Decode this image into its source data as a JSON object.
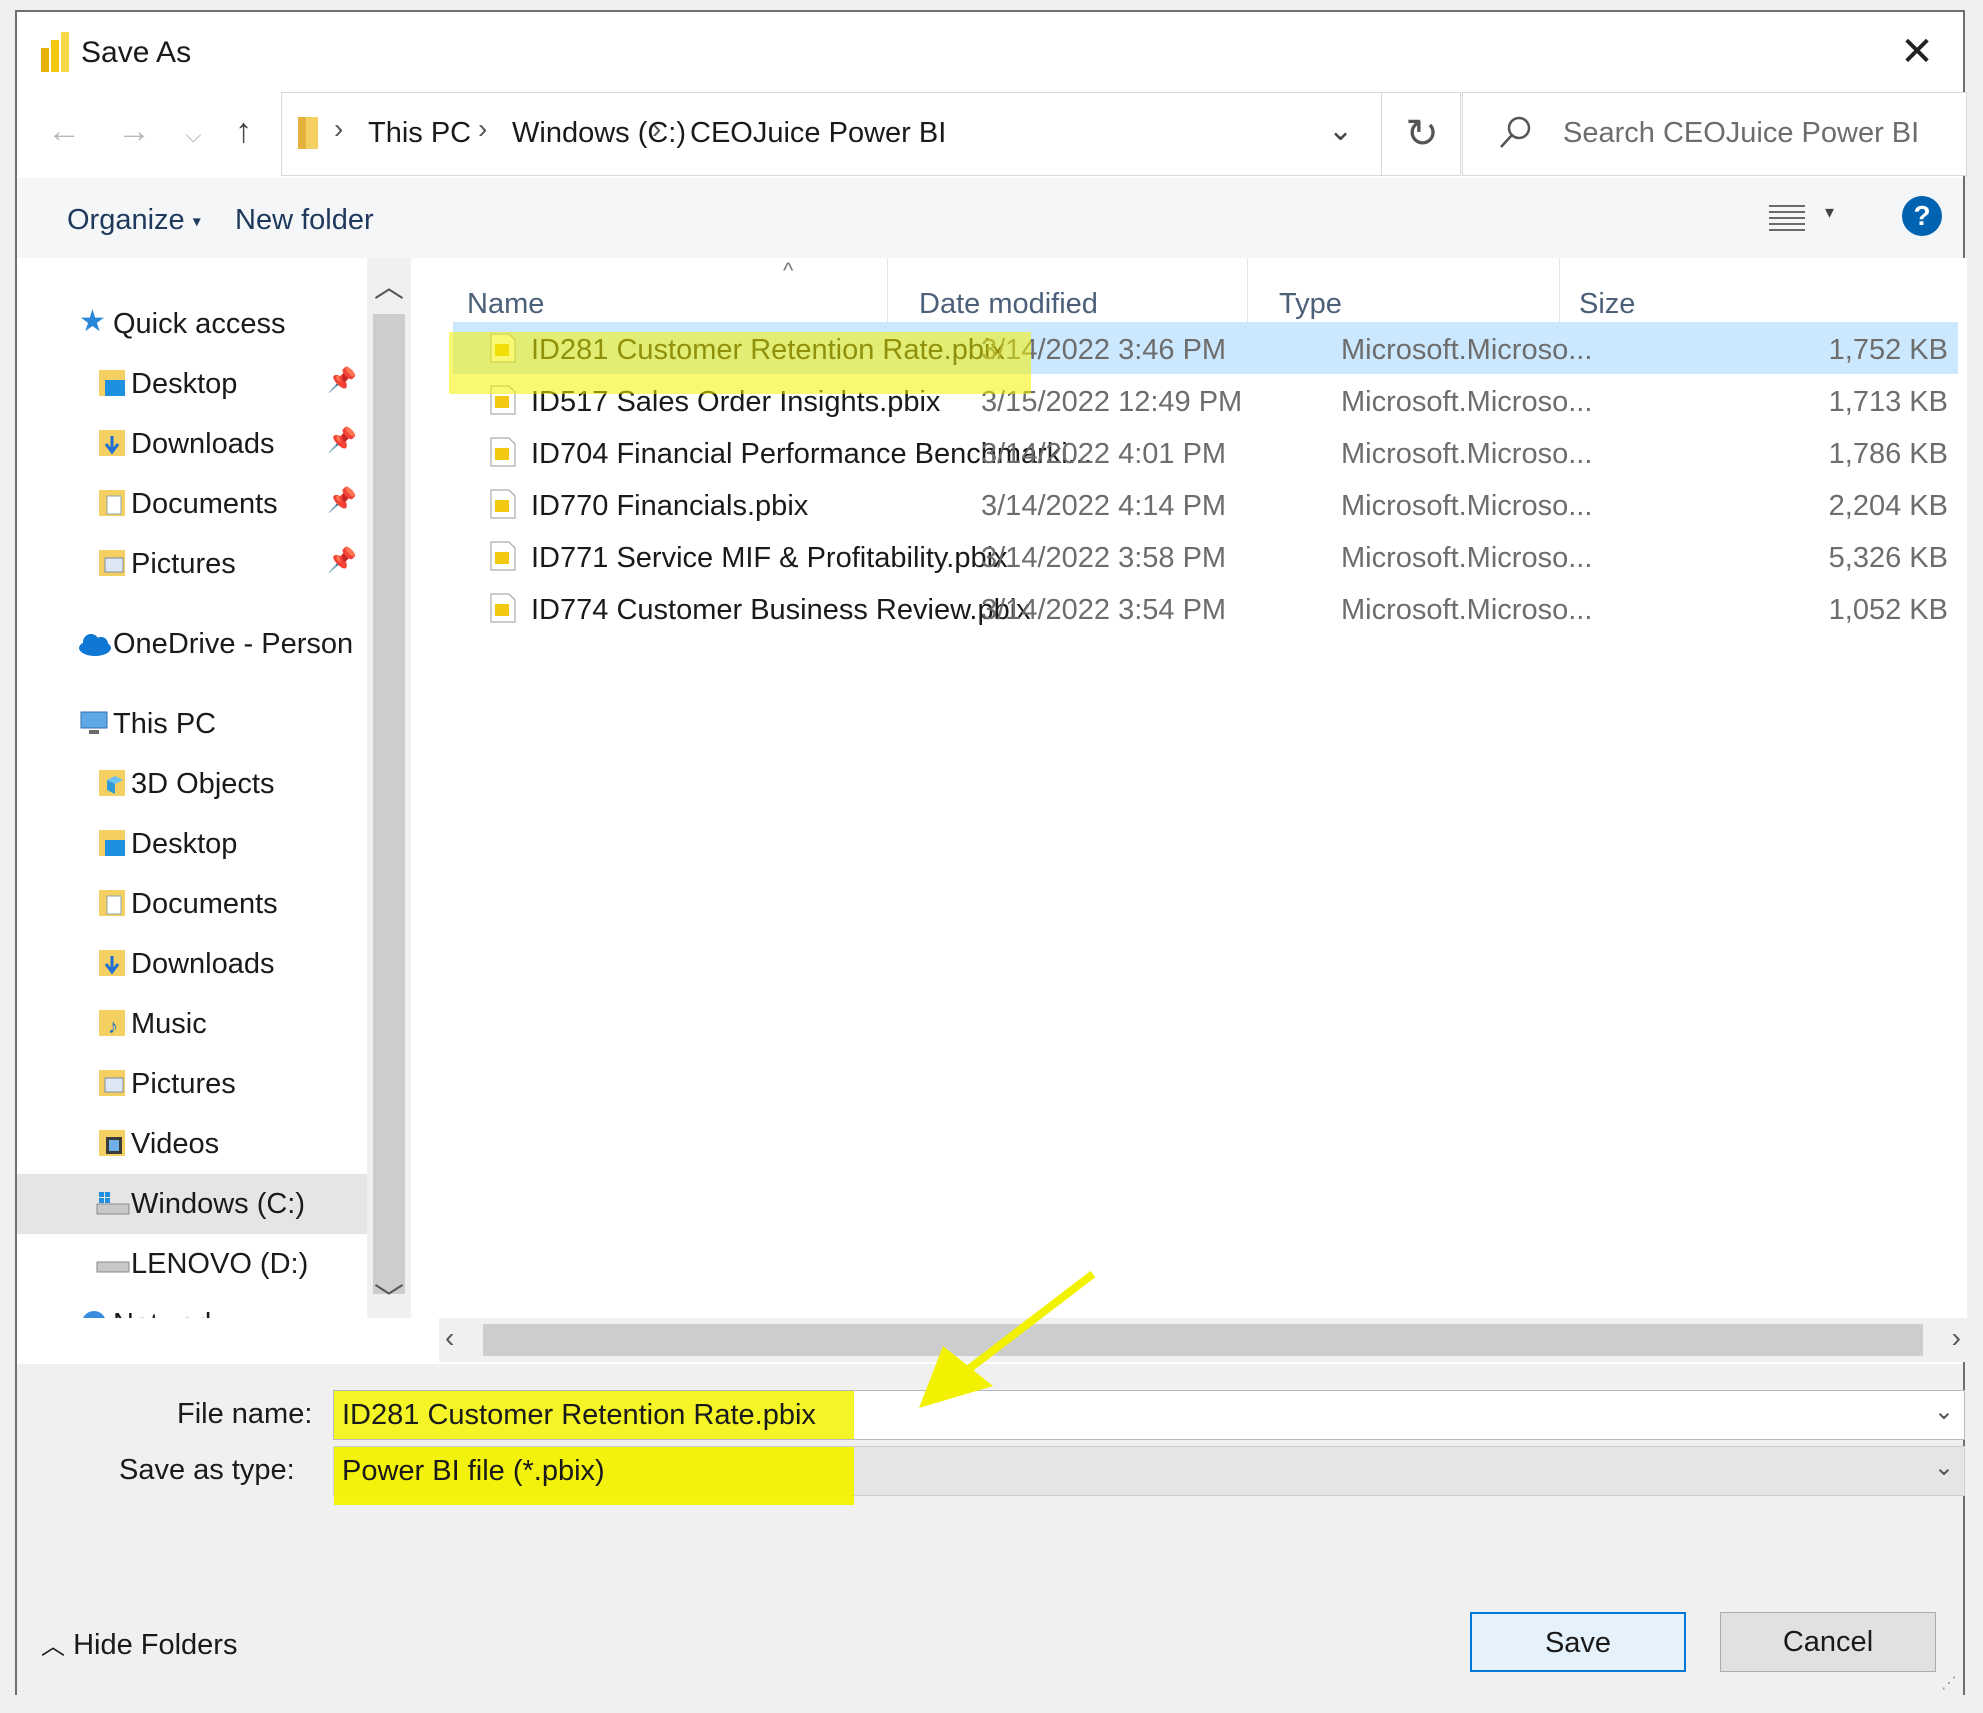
{
  "window": {
    "title": "Save As"
  },
  "address": {
    "breadcrumbs": [
      "This PC",
      "Windows (C:)",
      "CEOJuice Power BI"
    ],
    "search_placeholder": "Search CEOJuice Power BI"
  },
  "toolbar": {
    "organize": "Organize",
    "new_folder": "New folder",
    "help": "?"
  },
  "nav": {
    "quick_access": "Quick access",
    "quick_items": [
      "Desktop",
      "Downloads",
      "Documents",
      "Pictures"
    ],
    "onedrive": "OneDrive - Person",
    "this_pc": "This PC",
    "pc_items": [
      "3D Objects",
      "Desktop",
      "Documents",
      "Downloads",
      "Music",
      "Pictures",
      "Videos",
      "Windows (C:)",
      "LENOVO (D:)"
    ],
    "network": "Network"
  },
  "files": {
    "columns": [
      "Name",
      "Date modified",
      "Type",
      "Size"
    ],
    "rows": [
      {
        "name": "ID281 Customer Retention Rate.pbix",
        "date": "3/14/2022 3:46 PM",
        "type": "Microsoft.Microso...",
        "size": "1,752 KB"
      },
      {
        "name": "ID517 Sales Order Insights.pbix",
        "date": "3/15/2022 12:49 PM",
        "type": "Microsoft.Microso...",
        "size": "1,713 KB"
      },
      {
        "name": "ID704 Financial Performance Benchmarki...",
        "date": "3/14/2022 4:01 PM",
        "type": "Microsoft.Microso...",
        "size": "1,786 KB"
      },
      {
        "name": "ID770 Financials.pbix",
        "date": "3/14/2022 4:14 PM",
        "type": "Microsoft.Microso...",
        "size": "2,204 KB"
      },
      {
        "name": "ID771 Service MIF & Profitability.pbix",
        "date": "3/14/2022 3:58 PM",
        "type": "Microsoft.Microso...",
        "size": "5,326 KB"
      },
      {
        "name": "ID774 Customer Business Review.pbix",
        "date": "3/14/2022 3:54 PM",
        "type": "Microsoft.Microso...",
        "size": "1,052 KB"
      }
    ]
  },
  "form": {
    "file_name_label": "File name:",
    "file_name_value": "ID281 Customer Retention Rate.pbix",
    "save_type_label": "Save as type:",
    "save_type_value": "Power BI file (*.pbix)"
  },
  "buttons": {
    "save": "Save",
    "cancel": "Cancel",
    "hide_folders": "Hide Folders"
  },
  "colors": {
    "highlight": "#f2f200",
    "selection": "#cce8ff",
    "accent": "#0078d7",
    "arrow": "#f2f200"
  }
}
